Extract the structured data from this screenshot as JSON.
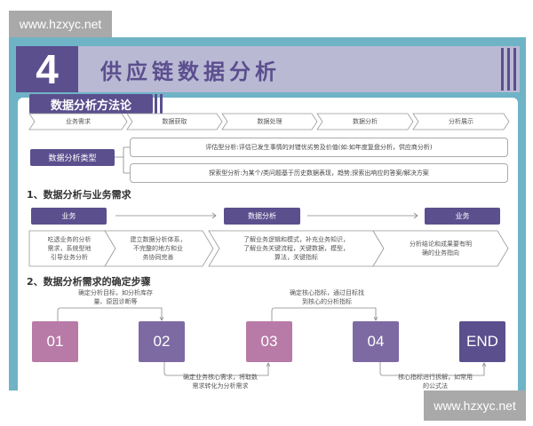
{
  "watermark": "www.hzxyc.net",
  "header": {
    "number": "4",
    "title": "供应链数据分析"
  },
  "methodology": {
    "title": "数据分析方法论",
    "steps": [
      "业务需求",
      "数据获取",
      "数据处理",
      "数据分析",
      "分析展示"
    ],
    "types_label": "数据分析类型",
    "types": [
      "评估型分析:评估已发生事情的对错优劣势及价值(如:如年度复盘分析，供应商分析)",
      "探索型分析:为某个/类问题基于历史数据表现，趋势;探索出响应的答案/解决方案"
    ]
  },
  "section1": {
    "title": "1、数据分析与业务需求",
    "nodes": [
      "业务",
      "数据分析",
      "业务"
    ],
    "descs": [
      "吃透业务的分析\n需求，系统型地\n引导业务分析",
      "建立数据分析体系，\n不完整的地方和业\n务协同完善",
      "了解业务逻辑和模式，补充业务知识，\n了解业务关键流程，关键数据，模型，\n算法，关键指标",
      "分析结论和成果要有明\n确的业务指向"
    ]
  },
  "section2": {
    "title": "2、数据分析需求的确定步骤",
    "steps": [
      "01",
      "02",
      "03",
      "04",
      "END"
    ],
    "notes": [
      "确定分析目标，如分析库存\n量、原因诊断等",
      "确定业务核心需求，将取数\n需求转化为分析需求",
      "确定核心指标，通过目标找\n到核心的分析指标",
      "核心指标进行拆解，如常用\n的公式法"
    ]
  },
  "colors": {
    "frame": "#6fb3c6",
    "purple": "#5b4f8e",
    "lavender": "#bab9d4",
    "pink": "#b87aa6",
    "mid_purple": "#7d6aa3"
  }
}
